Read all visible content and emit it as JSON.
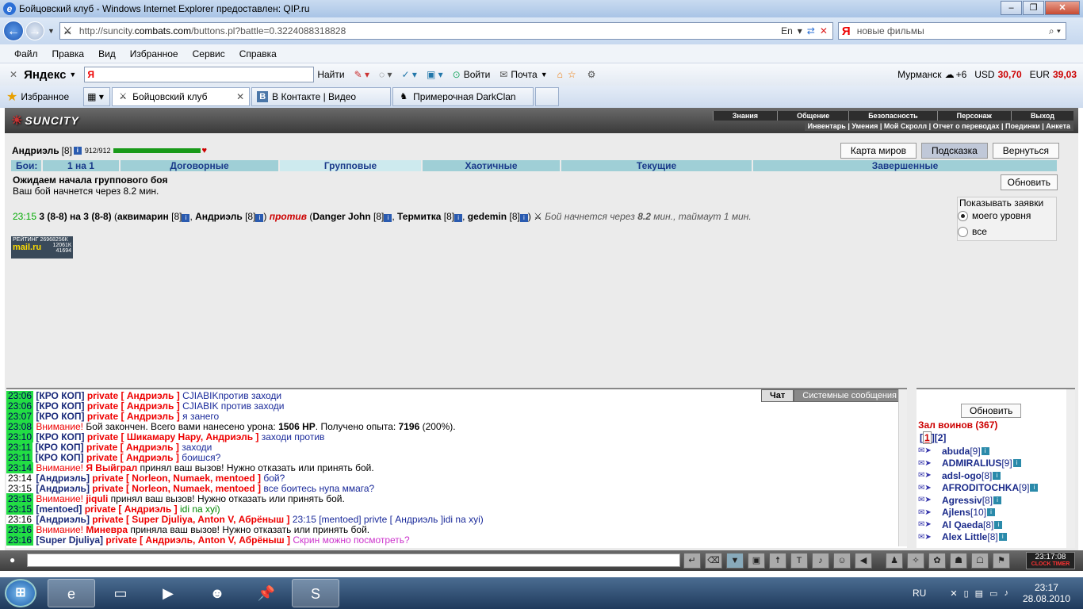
{
  "window": {
    "title": "Бойцовский клуб - Windows Internet Explorer предоставлен: QIP.ru"
  },
  "address": {
    "url_pre": "http://suncity.",
    "url_host": "combats.com",
    "url_post": "/buttons.pl?battle=0.3224088318828",
    "lang": "En",
    "search_placeholder": "новые фильмы"
  },
  "menu": [
    "Файл",
    "Правка",
    "Вид",
    "Избранное",
    "Сервис",
    "Справка"
  ],
  "yandex_bar": {
    "logo_main": "Яндекс",
    "input_text": "Я",
    "find": "Найти",
    "enter": "Войти",
    "mail": "Почта",
    "city": "Мурманск",
    "weather": "+6",
    "usd_label": "USD",
    "usd": "30,70",
    "eur_label": "EUR",
    "eur": "39,03"
  },
  "favbar": {
    "favorites": "Избранное",
    "tabs": [
      "Бойцовский клуб",
      "В Контакте | Видео",
      "Примерочная DarkClan"
    ]
  },
  "game": {
    "logo": "SUNCITY",
    "nav_top": [
      "Знания",
      "Общение",
      "Безопасность",
      "Персонаж",
      "Выход"
    ],
    "nav_bottom": "Инвентарь | Умения | Мой Скролл | Отчет о переводах | Поединки | Анкета",
    "hero": {
      "name": "Андриэль",
      "level": "[8]",
      "hp": "912/912"
    },
    "top_buttons": [
      "Карта миров",
      "Подсказка",
      "Вернуться"
    ],
    "fights_label": "Бои:",
    "fight_tabs": [
      "1 на 1",
      "Договорные",
      "Групповые",
      "Хаотичные",
      "Текущие",
      "Завершенные"
    ],
    "wait_title": "Ожидаем начала группового боя",
    "wait_sub": "Ваш бой начнется через 8.2 мин.",
    "refresh": "Обновить",
    "show_box": {
      "title": "Показывать заявки",
      "opt1": "моего уровня",
      "opt2": "все"
    },
    "battle": {
      "time": "23:15",
      "teams": "3 (8-8) на 3 (8-8)",
      "p1": "аквимарин",
      "p1lvl": "[8]",
      "p2": "Андриэль",
      "p2lvl": "[8]",
      "vs": "против",
      "p3": "Danger John",
      "p3lvl": "[8]",
      "p4": "Термитка",
      "p4lvl": "[8]",
      "p5": "gedemin",
      "p5lvl": "[8]",
      "start_text_a": "Бой начнется через",
      "start_mins": "8.2",
      "start_text_b": "мин., таймаут 1 мин."
    },
    "mailru": {
      "rating": "РЕЙТИНГ 26968256К",
      "logo": "mail.ru",
      "n1": "12061К",
      "n2": "41694"
    }
  },
  "chat": {
    "tabs": [
      "Чат",
      "Системные сообщения"
    ],
    "messages": [
      {
        "t": "23:06",
        "nick": "[КРО КОП]",
        "pr": "private [ Андриэль ]",
        "txt": "CJIABIKпротив заходи"
      },
      {
        "t": "23:06",
        "nick": "[КРО КОП]",
        "pr": "private [ Андриэль ]",
        "txt": "CJIABIK против заходи"
      },
      {
        "t": "23:07",
        "nick": "[КРО КОП]",
        "pr": "private [ Андриэль ]",
        "txt": "я занего"
      },
      {
        "t": "23:08",
        "att": "Внимание!",
        "plain": " Бой закончен. Всего вами нанесено урона: ",
        "b1": "1506 HP",
        "plain2": ". Получено опыта: ",
        "b2": "7196",
        "plain3": " (200%)."
      },
      {
        "t": "23:10",
        "nick": "[КРО КОП]",
        "pr": "private [ Шикамару Нару, Андриэль ]",
        "txt": "заходи против"
      },
      {
        "t": "23:11",
        "nick": "[КРО КОП]",
        "pr": "private [ Андриэль ]",
        "txt": "заходи"
      },
      {
        "t": "23:11",
        "nick": "[КРО КОП]",
        "pr": "private [ Андриэль ]",
        "txt": "боишся?"
      },
      {
        "t": "23:14",
        "att": "Внимание!",
        "who": "Я Выйграл",
        "plain": " принял ваш вызов! Нужно отказать или принять бой."
      },
      {
        "t": "23:14",
        "tw": true,
        "nick": "[Андриэль]",
        "pr": "private [ Norleon, Numaek, mentoed ]",
        "txt": "бой?"
      },
      {
        "t": "23:15",
        "tw": true,
        "nick": "[Андриэль]",
        "pr": "private [ Norleon, Numaek, mentoed ]",
        "txt": "все боитесь нупа ммага?"
      },
      {
        "t": "23:15",
        "att": "Внимание!",
        "who": "jiquli",
        "plain": " принял ваш вызов! Нужно отказать или принять бой."
      },
      {
        "t": "23:15",
        "nick": "[mentoed]",
        "pr": "private [ Андриэль ]",
        "green": "idi na xyi)"
      },
      {
        "t": "23:16",
        "tw": true,
        "nick": "[Андриэль]",
        "pr": "private [ Super Djuliya, Anton V, Абрёныш ]",
        "txt": "23:15 [mentoed] privte [ Андриэль ]idi na xyi)"
      },
      {
        "t": "23:16",
        "att": "Внимание!",
        "who": "Миневра",
        "plain": " приняла ваш вызов! Нужно отказать или принять бой."
      },
      {
        "t": "23:16",
        "nick": "[Super Djuliya]",
        "pr": "private [ Андриэль, Anton V, Абрёныш ]",
        "pink": "Скрин можно посмотреть?"
      }
    ]
  },
  "side": {
    "refresh": "Обновить",
    "hall": "Зал воинов (367)",
    "page_cur": "1",
    "page_other": "2",
    "players": [
      {
        "name": "abuda",
        "lvl": "[9]"
      },
      {
        "name": "ADMIRALIUS",
        "lvl": "[9]"
      },
      {
        "name": "adsl-ogo",
        "lvl": "[8]"
      },
      {
        "name": "AFRODITOCHKA",
        "lvl": "[9]"
      },
      {
        "name": "Agressiv",
        "lvl": "[8]"
      },
      {
        "name": "Ajlens",
        "lvl": "[10]"
      },
      {
        "name": "Al Qaeda",
        "lvl": "[8]"
      },
      {
        "name": "Alex Little",
        "lvl": "[8]"
      }
    ]
  },
  "clock": {
    "time": "23:17",
    "sec": "08",
    "labels": "CLOCK TIMER"
  },
  "taskbar": {
    "lang": "RU",
    "time": "23:17",
    "date": "28.08.2010"
  }
}
